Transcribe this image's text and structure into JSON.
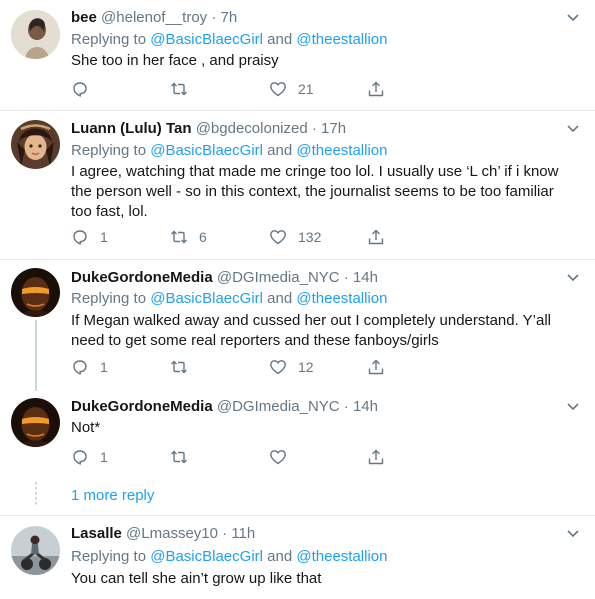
{
  "reply_prefix": "Replying to",
  "reply_and": "and",
  "tweets": [
    {
      "name": "bee",
      "handle": "@helenof__troy",
      "time": "7h",
      "mentions": [
        "@BasicBlaecGirl",
        "@theestallion"
      ],
      "text": "She too in her face , and praisy",
      "replies": "",
      "retweets": "",
      "likes": "21"
    },
    {
      "name": "Luann (Lulu) Tan",
      "handle": "@bgdecolonized",
      "time": "17h",
      "mentions": [
        "@BasicBlaecGirl",
        "@theestallion"
      ],
      "text": "I agree, watching that made me cringe too lol. I usually use ‘L  ch’ if i know the person well - so in this context, the journalist seems to be too familiar too fast, lol.",
      "replies": "1",
      "retweets": "6",
      "likes": "132"
    },
    {
      "name": "DukeGordoneMedia",
      "handle": "@DGImedia_NYC",
      "time": "14h",
      "mentions": [
        "@BasicBlaecGirl",
        "@theestallion"
      ],
      "text": "If Megan walked away and cussed her out I completely understand. Y’all need to get some real reporters and these fanboys/girls",
      "replies": "1",
      "retweets": "",
      "likes": "12"
    },
    {
      "name": "DukeGordoneMedia",
      "handle": "@DGImedia_NYC",
      "time": "14h",
      "mentions": [],
      "text": "Not*",
      "replies": "1",
      "retweets": "",
      "likes": ""
    },
    {
      "name": "Lasalle",
      "handle": "@Lmassey10",
      "time": "11h",
      "mentions": [
        "@BasicBlaecGirl",
        "@theestallion"
      ],
      "text": "You can tell she ain’t grow up like that",
      "replies": "",
      "retweets": "",
      "likes": ""
    }
  ],
  "more_replies": "1 more reply",
  "colors": {
    "link": "#1da1f2",
    "secondary_text": "#657786",
    "divider": "#e6ecf0",
    "thread_line": "#ccd6dd"
  },
  "icons": [
    "reply-icon",
    "retweet-icon",
    "like-icon",
    "share-icon",
    "chevron-down-icon"
  ]
}
